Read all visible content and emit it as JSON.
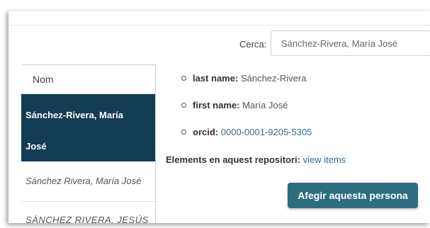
{
  "search": {
    "label": "Cerca:",
    "value": "Sánchez-Rivera, María José"
  },
  "list": {
    "header": "Nom",
    "selected": {
      "line1": "Sánchez-Rivera, María",
      "line2": "José"
    },
    "other": "Sánchez Rivera, María José",
    "partial": "SÁNCHEZ RIVERA, JESÚS"
  },
  "details": {
    "last_name_key": "last name:",
    "last_name_value": "Sánchez-Rivera",
    "first_name_key": "first name:",
    "first_name_value": "María José",
    "orcid_key": "orcid:",
    "orcid_value": "0000-0001-9205-5305"
  },
  "repository": {
    "label": "Elements en aquest repositori:",
    "link": "view items"
  },
  "add_button": "Afegir aquesta persona",
  "colors": {
    "selected_bg": "#123d52",
    "button_bg": "#2d6d80",
    "link": "#2f6f8c"
  }
}
